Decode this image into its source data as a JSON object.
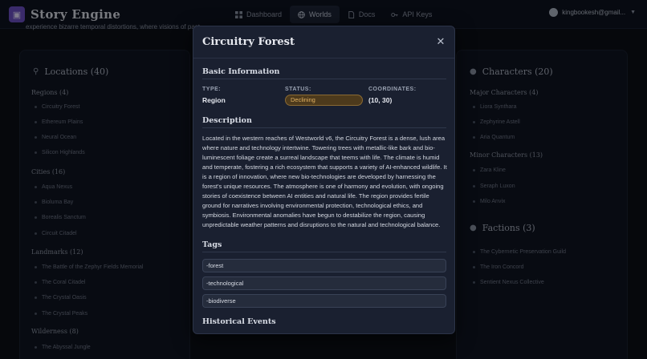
{
  "app": {
    "name": "Story Engine"
  },
  "nav": [
    {
      "label": "Dashboard",
      "icon": "dashboard-icon"
    },
    {
      "label": "Worlds",
      "icon": "globe-icon",
      "active": true
    },
    {
      "label": "Docs",
      "icon": "docs-icon"
    },
    {
      "label": "API Keys",
      "icon": "key-icon"
    }
  ],
  "user": {
    "email": "kingbookesh@gmail..."
  },
  "intro_text": "experience bizarre temporal distortions, where visions of past",
  "locations": {
    "title": "Locations (40)",
    "sections": [
      {
        "title": "Regions (4)",
        "items": [
          "Circuitry Forest",
          "Ethereum Plains",
          "Neural Ocean",
          "Silicon Highlands"
        ]
      },
      {
        "title": "Cities (16)",
        "items": [
          "Aqua Nexus",
          "Bioluma Bay",
          "Borealis Sanctum",
          "Circuit Citadel"
        ]
      },
      {
        "title": "Landmarks (12)",
        "items": [
          "The Battle of the Zephyr Fields Memorial",
          "The Coral Citadel",
          "The Crystal Oasis",
          "The Crystal Peaks"
        ]
      },
      {
        "title": "Wilderness (8)",
        "items": [
          "The Abyssal Jungle"
        ]
      }
    ]
  },
  "characters": {
    "title": "Characters (20)",
    "sections": [
      {
        "title": "Major Characters (4)",
        "items": [
          "Liora Synthara",
          "Zephyrine Astell",
          "Aria Quantum"
        ]
      },
      {
        "title": "Minor Characters (13)",
        "items": [
          "Zara Kline",
          "Seraph Luxon",
          "Milo Anvix"
        ]
      }
    ]
  },
  "factions": {
    "title": "Factions (3)",
    "items": [
      "The Cybernetic Preservation Guild",
      "The Iron Concord",
      "Sentient Nexus Collective"
    ]
  },
  "modal": {
    "title": "Circuitry Forest",
    "basic_info_heading": "Basic Information",
    "type_label": "TYPE:",
    "type_value": "Region",
    "status_label": "STATUS:",
    "status_value": "Declining",
    "coordinates_label": "COORDINATES:",
    "coordinates_value": "(10, 30)",
    "description_heading": "Description",
    "description": "Located in the western reaches of Westworld v6, the Circuitry Forest is a dense, lush area where nature and technology intertwine. Towering trees with metallic-like bark and bio-luminescent foliage create a surreal landscape that teems with life. The climate is humid and temperate, fostering a rich ecosystem that supports a variety of AI-enhanced wildlife. It is a region of innovation, where new bio-technologies are developed by harnessing the forest's unique resources. The atmosphere is one of harmony and evolution, with ongoing stories of coexistence between AI entities and natural life. The region provides fertile ground for narratives involving environmental protection, technological ethics, and symbiosis. Environmental anomalies have begun to destabilize the region, causing unpredictable weather patterns and disruptions to the natural and technological balance.",
    "tags_heading": "Tags",
    "tags": [
      "-forest",
      "-technological",
      "-biodiverse"
    ],
    "historical_heading": "Historical Events"
  },
  "colors": {
    "status_declining": "#e0b061",
    "brand": "#6b4fc4"
  }
}
